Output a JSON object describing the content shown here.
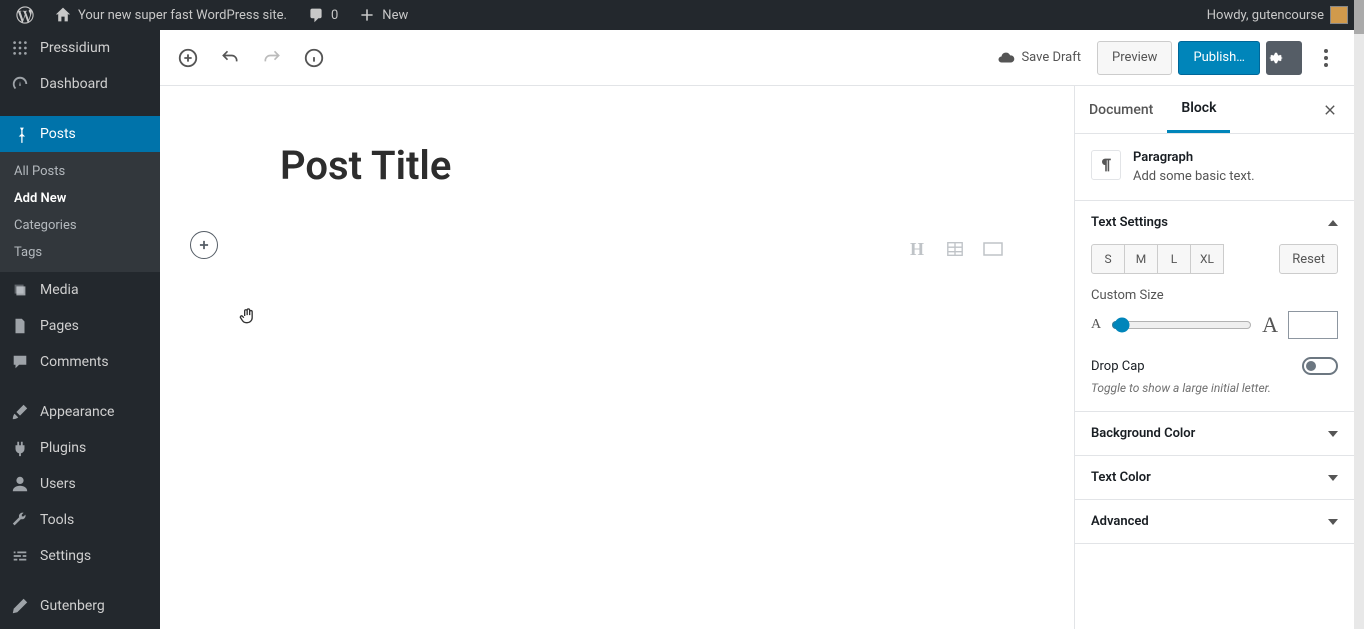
{
  "adminbar": {
    "site_name": "Your new super fast WordPress site.",
    "comments_count": "0",
    "new_label": "New",
    "howdy": "Howdy, gutencourse"
  },
  "sidebar": {
    "host": "Pressidium",
    "items": [
      {
        "label": "Dashboard"
      },
      {
        "label": "Posts"
      },
      {
        "label": "Media"
      },
      {
        "label": "Pages"
      },
      {
        "label": "Comments"
      },
      {
        "label": "Appearance"
      },
      {
        "label": "Plugins"
      },
      {
        "label": "Users"
      },
      {
        "label": "Tools"
      },
      {
        "label": "Settings"
      },
      {
        "label": "Gutenberg"
      }
    ],
    "posts_sub": [
      {
        "label": "All Posts"
      },
      {
        "label": "Add New"
      },
      {
        "label": "Categories"
      },
      {
        "label": "Tags"
      }
    ]
  },
  "editor": {
    "save_draft": "Save Draft",
    "preview": "Preview",
    "publish": "Publish…",
    "post_title": "Post Title"
  },
  "settings": {
    "tabs": {
      "document": "Document",
      "block": "Block"
    },
    "block_info": {
      "title": "Paragraph",
      "desc": "Add some basic text."
    },
    "text_settings": {
      "title": "Text Settings",
      "sizes": [
        "S",
        "M",
        "L",
        "XL"
      ],
      "reset": "Reset",
      "custom_size": "Custom Size",
      "dropcap": "Drop Cap",
      "dropcap_help": "Toggle to show a large initial letter."
    },
    "panels": {
      "bg_color": "Background Color",
      "text_color": "Text Color",
      "advanced": "Advanced"
    }
  }
}
